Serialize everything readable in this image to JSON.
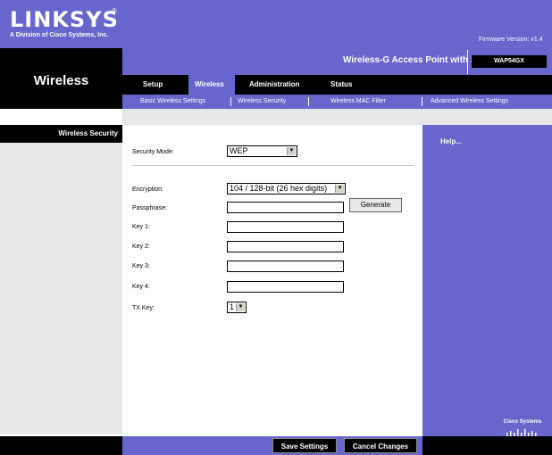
{
  "brand": {
    "logo": "LINKSYS",
    "reg": "®",
    "subtitle": "A Division of Cisco Systems, Inc.",
    "firmware": "Firmware Version: v1.4"
  },
  "product": {
    "name": "Wireless-G Access Point with SRX",
    "model": "WAP54GX"
  },
  "section_title": "Wireless",
  "tabs": [
    "Setup",
    "Wireless",
    "Administration",
    "Status"
  ],
  "active_tab": "Wireless",
  "subtabs": [
    "Basic Wireless Settings",
    "Wireless Security",
    "Wireless MAC Filter",
    "Advanced Wireless Settings"
  ],
  "left_section": "Wireless Security",
  "form": {
    "security_mode_label": "Security Mode:",
    "security_mode_value": "WEP",
    "encryption_label": "Encryption:",
    "encryption_value": "104 / 128-bit (26 hex digits)",
    "passphrase_label": "Passphrase:",
    "generate_label": "Generate",
    "key1_label": "Key 1:",
    "key2_label": "Key 2:",
    "key3_label": "Key 3:",
    "key4_label": "Key 4:",
    "txkey_label": "TX Key:",
    "txkey_value": "1"
  },
  "help_label": "Help...",
  "cisco_label": "Cisco Systems",
  "footer": {
    "save": "Save Settings",
    "cancel": "Cancel Changes"
  },
  "colors": {
    "brand_purple": "#6666cc",
    "black": "#000000"
  }
}
